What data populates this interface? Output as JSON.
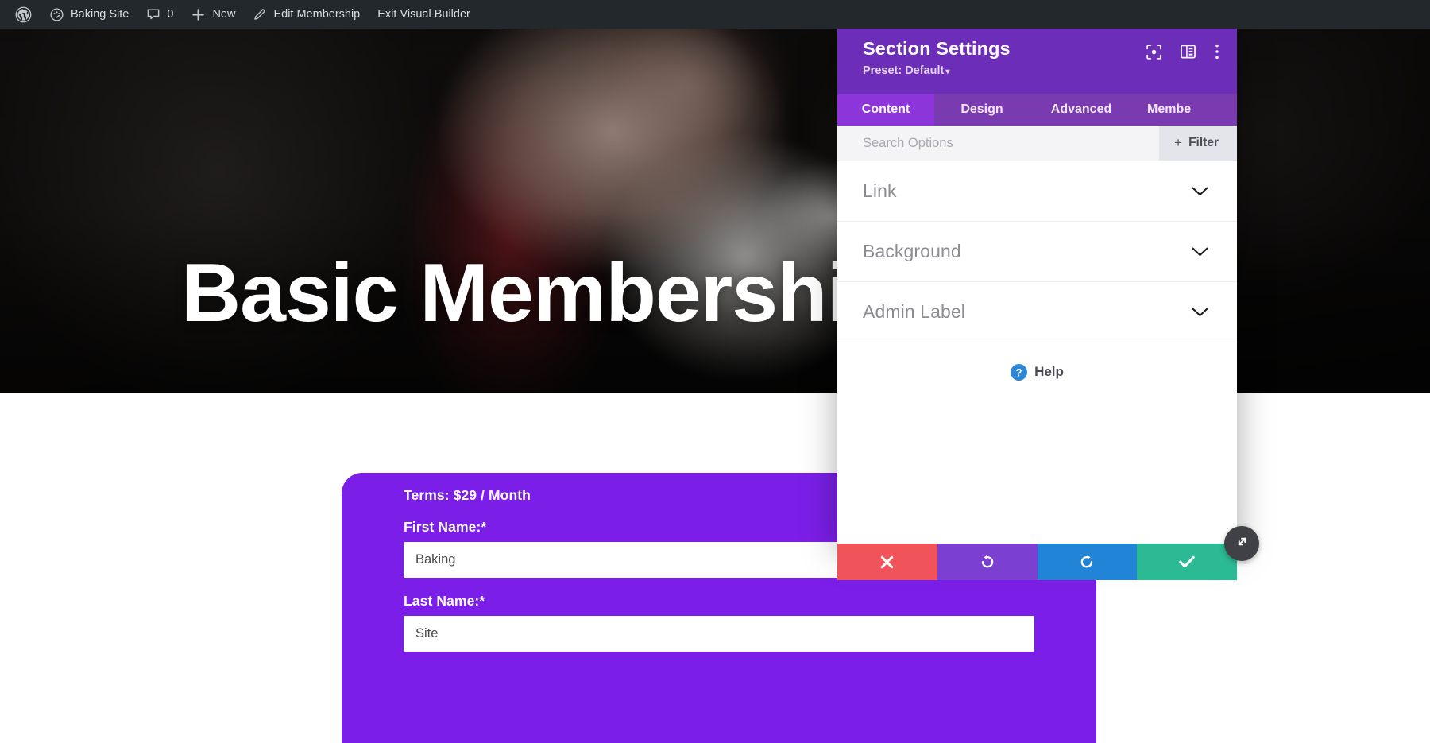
{
  "admin_bar": {
    "items": [
      {
        "icon": "wordpress-logo-icon",
        "label": ""
      },
      {
        "icon": "dashboard-icon",
        "label": "Baking Site"
      },
      {
        "icon": "comment-bubble-icon",
        "label": "0"
      },
      {
        "icon": "plus-icon",
        "label": "New"
      },
      {
        "icon": "pencil-icon",
        "label": "Edit Membership"
      },
      {
        "icon": "",
        "label": "Exit Visual Builder"
      }
    ],
    "background_color": "#23282d"
  },
  "hero": {
    "title": "Basic Membership",
    "divider": "underline-rule"
  },
  "form": {
    "terms": "Terms: $29 / Month",
    "card_color": "#7b1fe8",
    "fields": [
      {
        "label": "First Name:*",
        "value": "Baking",
        "placeholder": "",
        "icon": "contact-card-icon"
      },
      {
        "label": "Last Name:*",
        "value": "Site",
        "placeholder": "",
        "icon": ""
      }
    ]
  },
  "settings_panel": {
    "title": "Section Settings",
    "preset_label": "Preset: Default",
    "preset_caret": "▾",
    "header_color": "#6c2eb8",
    "header_icons": [
      {
        "name": "focus-target-icon"
      },
      {
        "name": "layout-panel-icon"
      },
      {
        "name": "kebab-menu-icon"
      }
    ],
    "tabs": [
      {
        "label": "Content",
        "active": true
      },
      {
        "label": "Design",
        "active": false
      },
      {
        "label": "Advanced",
        "active": false
      },
      {
        "label": "Membe",
        "active": false
      }
    ],
    "search": {
      "placeholder": "Search Options",
      "value": ""
    },
    "filter_button": {
      "label": "Filter",
      "plus": "+"
    },
    "accordions": [
      {
        "label": "Link",
        "expanded": false
      },
      {
        "label": "Background",
        "expanded": false
      },
      {
        "label": "Admin Label",
        "expanded": false
      }
    ],
    "help": {
      "label": "Help",
      "icon": "question-circle-icon"
    },
    "actions": [
      {
        "name": "cancel",
        "icon": "close-x-icon",
        "color": "#f0545a"
      },
      {
        "name": "undo",
        "icon": "undo-arrow-icon",
        "color": "#7b40d1"
      },
      {
        "name": "redo",
        "icon": "redo-arrow-icon",
        "color": "#2284d6"
      },
      {
        "name": "save",
        "icon": "checkmark-icon",
        "color": "#2bba94"
      }
    ],
    "resize_handle": {
      "icon": "diagonal-resize-icon"
    }
  }
}
